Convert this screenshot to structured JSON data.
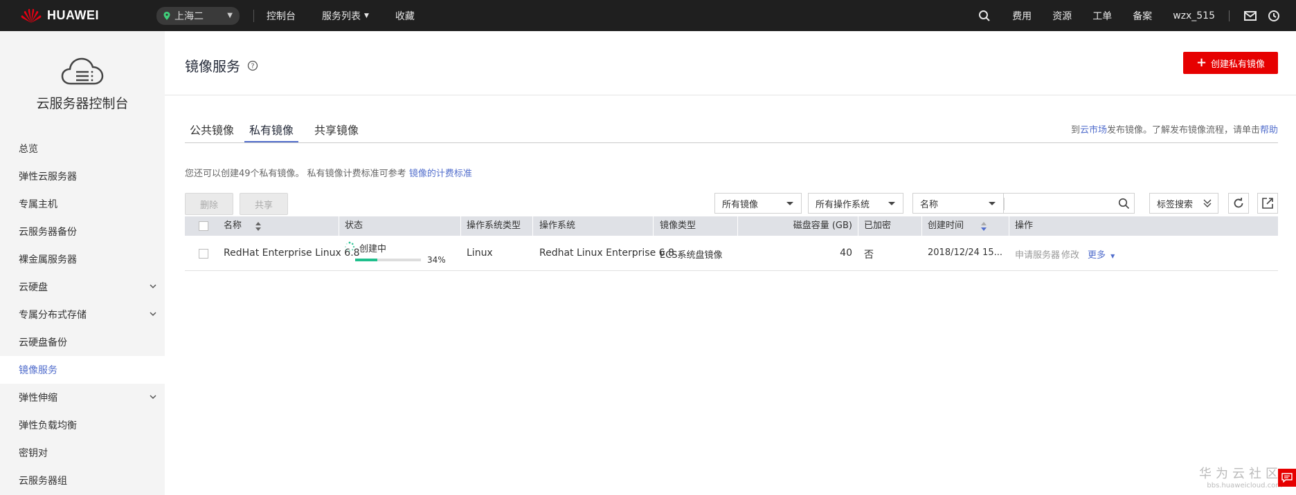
{
  "topbar": {
    "brand": "HUAWEI",
    "region": "上海二",
    "nav": [
      "控制台",
      "服务列表",
      "收藏"
    ],
    "right": [
      "费用",
      "资源",
      "工单",
      "备案",
      "wzx_515"
    ]
  },
  "sidebar": {
    "title": "云服务器控制台",
    "items": [
      {
        "label": "总览"
      },
      {
        "label": "弹性云服务器"
      },
      {
        "label": "专属主机"
      },
      {
        "label": "云服务器备份"
      },
      {
        "label": "裸金属服务器"
      },
      {
        "label": "云硬盘"
      },
      {
        "label": "专属分布式存储"
      },
      {
        "label": "云硬盘备份"
      },
      {
        "label": "镜像服务"
      },
      {
        "label": "弹性伸缩"
      },
      {
        "label": "弹性负载均衡"
      },
      {
        "label": "密钥对"
      },
      {
        "label": "云服务器组"
      }
    ]
  },
  "page": {
    "title": "镜像服务",
    "create_button": "创建私有镜像"
  },
  "tabs": {
    "items": [
      "公共镜像",
      "私有镜像",
      "共享镜像"
    ],
    "active": "私有镜像",
    "hint_prefix": "到",
    "hint_link1": "云市场",
    "hint_middle": "发布镜像。了解发布镜像流程，请单击",
    "hint_link2": "帮助"
  },
  "notice": {
    "text": "您还可以创建49个私有镜像。 私有镜像计费标准可参考 ",
    "link": "镜像的计费标准"
  },
  "toolbar": {
    "delete": "删除",
    "share": "共享",
    "filter_image": "所有镜像",
    "filter_os": "所有操作系统",
    "search_field": "名称",
    "search_value": "",
    "tag_search": "标签搜索"
  },
  "table": {
    "headers": [
      "名称",
      "状态",
      "操作系统类型",
      "操作系统",
      "镜像类型",
      "磁盘容量 (GB)",
      "已加密",
      "创建时间",
      "操作"
    ],
    "rows": [
      {
        "name": "RedHat Enterprise Linux 6.8",
        "status": "创建中",
        "progress_text": "34%",
        "progress": 34,
        "os_type": "Linux",
        "os": "Redhat Linux Enterprise 6.8 ...",
        "image_type": "ECS系统盘镜像",
        "disk": "40",
        "encrypted": "否",
        "created": "2018/12/24 15...",
        "action_apply": "申请服务器",
        "action_modify": "修改",
        "action_more": "更多"
      }
    ]
  },
  "watermark": {
    "big": "华为云社区",
    "small": "bbs.huaweicloud.com"
  },
  "colors": {
    "topbar": "#1f1f1f",
    "accent": "#526ecc",
    "brand_red": "#e60000",
    "progress": "#1fbf8c"
  }
}
